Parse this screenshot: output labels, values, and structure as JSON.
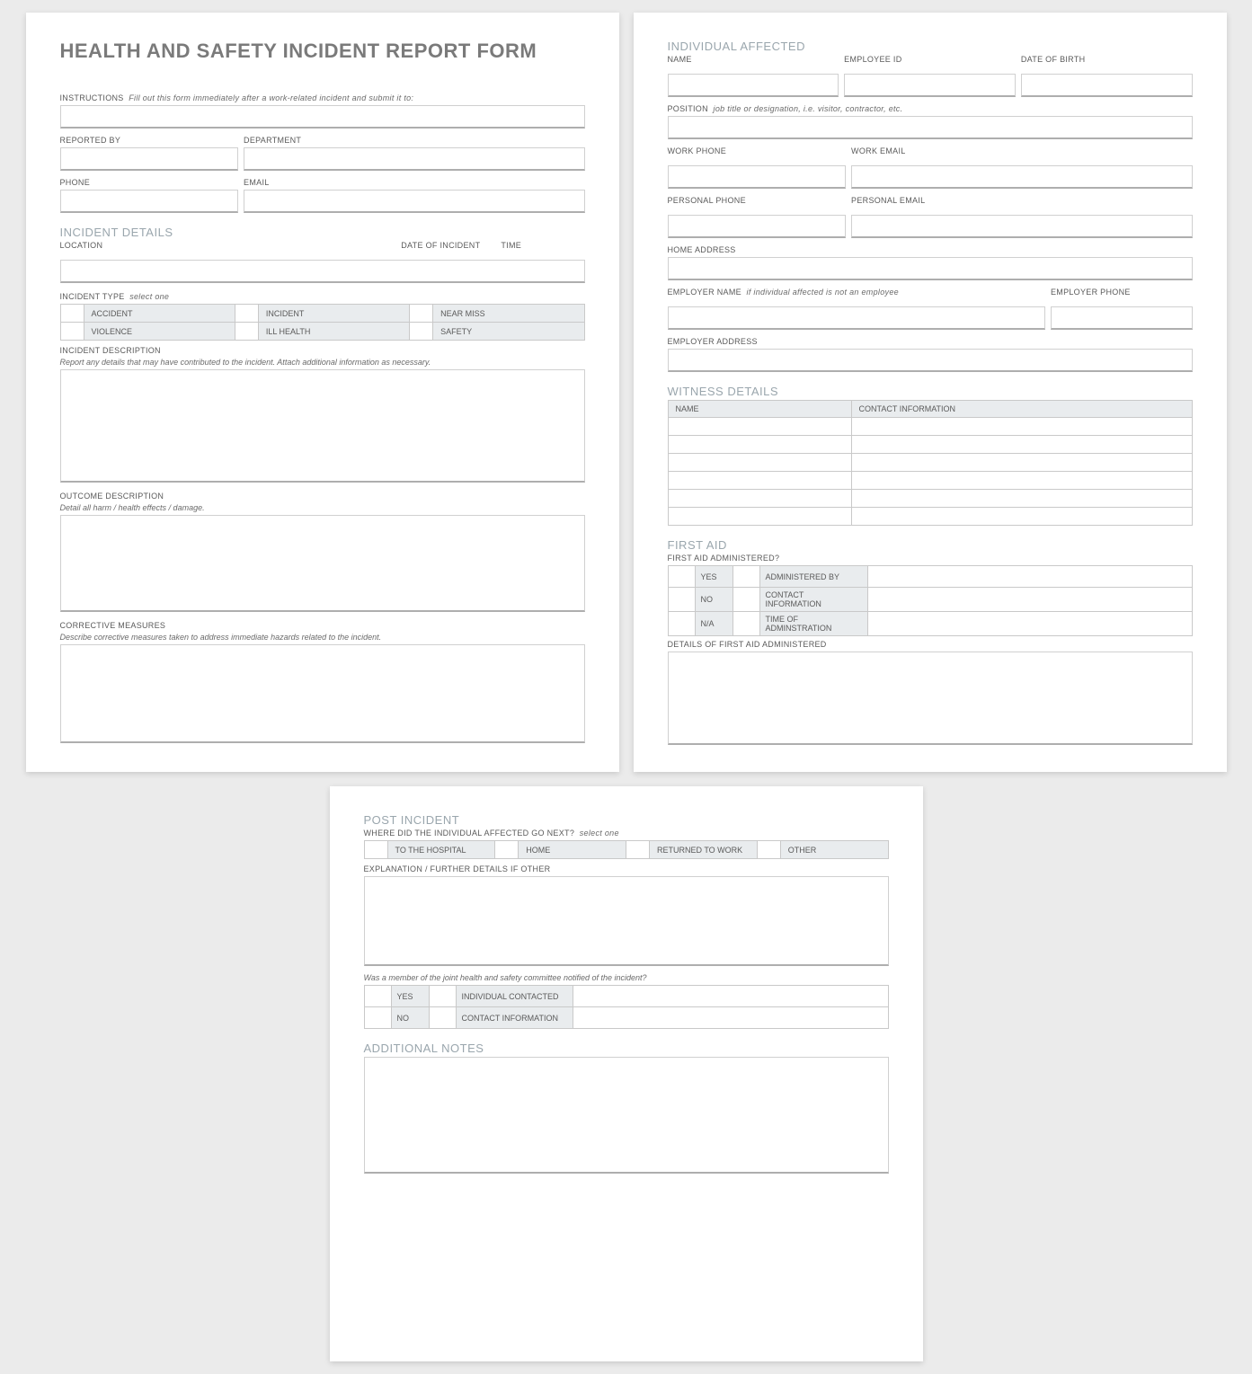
{
  "title": "HEALTH AND SAFETY INCIDENT REPORT FORM",
  "instructions": {
    "label": "INSTRUCTIONS",
    "hint": "Fill out this form immediately after a work-related incident and submit it to:"
  },
  "reporter": {
    "reported_by": "REPORTED BY",
    "department": "DEPARTMENT",
    "phone": "PHONE",
    "email": "EMAIL"
  },
  "incident": {
    "heading": "INCIDENT DETAILS",
    "location": "LOCATION",
    "date": "DATE OF INCIDENT",
    "time": "TIME",
    "type_label": "INCIDENT TYPE",
    "type_hint": "select one",
    "types": [
      "ACCIDENT",
      "INCIDENT",
      "NEAR MISS",
      "VIOLENCE",
      "ILL HEALTH",
      "SAFETY"
    ],
    "desc_label": "INCIDENT DESCRIPTION",
    "desc_hint": "Report any details that may have contributed to the incident.  Attach additional information as necessary.",
    "outcome_label": "OUTCOME DESCRIPTION",
    "outcome_hint": "Detail all harm / health effects / damage.",
    "corrective_label": "CORRECTIVE MEASURES",
    "corrective_hint": "Describe corrective measures taken to address immediate hazards related to the incident."
  },
  "individual": {
    "heading": "INDIVIDUAL AFFECTED",
    "name": "NAME",
    "employee_id": "EMPLOYEE ID",
    "dob": "DATE OF BIRTH",
    "position_label": "POSITION",
    "position_hint": "job title or designation, i.e. visitor, contractor, etc.",
    "work_phone": "WORK PHONE",
    "work_email": "WORK EMAIL",
    "personal_phone": "PERSONAL PHONE",
    "personal_email": "PERSONAL EMAIL",
    "home_address": "HOME ADDRESS",
    "employer_name_label": "EMPLOYER NAME",
    "employer_name_hint": "if individual affected is not an employee",
    "employer_phone": "EMPLOYER PHONE",
    "employer_address": "EMPLOYER ADDRESS"
  },
  "witness": {
    "heading": "WITNESS DETAILS",
    "col_name": "NAME",
    "col_contact": "CONTACT INFORMATION",
    "rows": 6
  },
  "firstaid": {
    "heading": "FIRST AID",
    "question": "FIRST AID ADMINISTERED?",
    "opts": [
      "YES",
      "NO",
      "N/A"
    ],
    "admin_by": "ADMINISTERED BY",
    "contact": "CONTACT INFORMATION",
    "time": "TIME OF ADMINSTRATION",
    "details_label": "DETAILS OF FIRST AID ADMINISTERED"
  },
  "post": {
    "heading": "POST INCIDENT",
    "where_label": "WHERE DID THE INDIVIDUAL AFFECTED GO NEXT?",
    "where_hint": "select one",
    "where_opts": [
      "TO THE HOSPITAL",
      "HOME",
      "RETURNED TO WORK",
      "OTHER"
    ],
    "explanation": "EXPLANATION / FURTHER DETAILS IF OTHER",
    "committee_q": "Was a member of the joint health and safety committee notified of the incident?",
    "committee_opts": [
      "YES",
      "NO"
    ],
    "ind_contacted": "INDIVIDUAL CONTACTED",
    "contact_info": "CONTACT INFORMATION"
  },
  "notes": {
    "heading": "ADDITIONAL NOTES"
  }
}
